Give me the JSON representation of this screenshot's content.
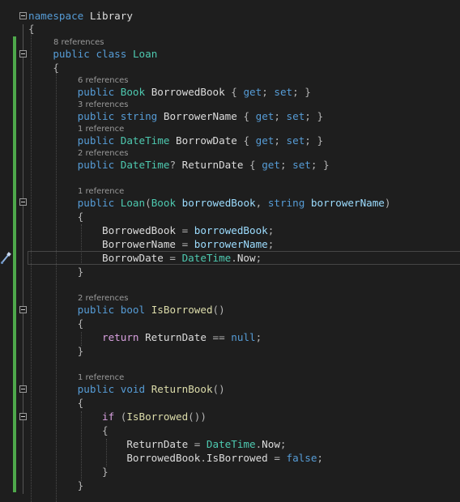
{
  "editor": {
    "lines": [
      {
        "tokens": [
          {
            "t": "namespace",
            "c": "kw"
          },
          {
            "t": " "
          },
          {
            "t": "Library",
            "c": "pr"
          }
        ]
      },
      {
        "tokens": [
          {
            "t": "{",
            "c": "pu"
          }
        ]
      },
      {
        "lens": "8 references",
        "tokens": [
          {
            "t": "    "
          },
          {
            "t": "public",
            "c": "kw"
          },
          {
            "t": " "
          },
          {
            "t": "class",
            "c": "kw"
          },
          {
            "t": " "
          },
          {
            "t": "Loan",
            "c": "ty"
          }
        ]
      },
      {
        "tokens": [
          {
            "t": "    "
          },
          {
            "t": "{",
            "c": "pu"
          }
        ]
      },
      {
        "lens": "6 references",
        "tokens": [
          {
            "t": "        "
          },
          {
            "t": "public",
            "c": "kw"
          },
          {
            "t": " "
          },
          {
            "t": "Book",
            "c": "ty"
          },
          {
            "t": " "
          },
          {
            "t": "BorrowedBook",
            "c": "pr"
          },
          {
            "t": " { ",
            "c": "pu"
          },
          {
            "t": "get",
            "c": "kw"
          },
          {
            "t": "; ",
            "c": "pu"
          },
          {
            "t": "set",
            "c": "kw"
          },
          {
            "t": "; }",
            "c": "pu"
          }
        ]
      },
      {
        "lens": "3 references",
        "tokens": [
          {
            "t": "        "
          },
          {
            "t": "public",
            "c": "kw"
          },
          {
            "t": " "
          },
          {
            "t": "string",
            "c": "kw"
          },
          {
            "t": " "
          },
          {
            "t": "BorrowerName",
            "c": "pr"
          },
          {
            "t": " { ",
            "c": "pu"
          },
          {
            "t": "get",
            "c": "kw"
          },
          {
            "t": "; ",
            "c": "pu"
          },
          {
            "t": "set",
            "c": "kw"
          },
          {
            "t": "; }",
            "c": "pu"
          }
        ]
      },
      {
        "lens": "1 reference",
        "tokens": [
          {
            "t": "        "
          },
          {
            "t": "public",
            "c": "kw"
          },
          {
            "t": " "
          },
          {
            "t": "DateTime",
            "c": "ty"
          },
          {
            "t": " "
          },
          {
            "t": "BorrowDate",
            "c": "pr"
          },
          {
            "t": " { ",
            "c": "pu"
          },
          {
            "t": "get",
            "c": "kw"
          },
          {
            "t": "; ",
            "c": "pu"
          },
          {
            "t": "set",
            "c": "kw"
          },
          {
            "t": "; }",
            "c": "pu"
          }
        ]
      },
      {
        "lens": "2 references",
        "tokens": [
          {
            "t": "        "
          },
          {
            "t": "public",
            "c": "kw"
          },
          {
            "t": " "
          },
          {
            "t": "DateTime",
            "c": "ty"
          },
          {
            "t": "? ",
            "c": "pu"
          },
          {
            "t": "ReturnDate",
            "c": "pr"
          },
          {
            "t": " { ",
            "c": "pu"
          },
          {
            "t": "get",
            "c": "kw"
          },
          {
            "t": "; ",
            "c": "pu"
          },
          {
            "t": "set",
            "c": "kw"
          },
          {
            "t": "; }",
            "c": "pu"
          }
        ]
      },
      {
        "lens": "1 reference",
        "tokens": [
          {
            "t": "        "
          },
          {
            "t": "public",
            "c": "kw"
          },
          {
            "t": " "
          },
          {
            "t": "Loan",
            "c": "ty"
          },
          {
            "t": "(",
            "c": "pu"
          },
          {
            "t": "Book",
            "c": "ty"
          },
          {
            "t": " "
          },
          {
            "t": "borrowedBook",
            "c": "pm"
          },
          {
            "t": ", ",
            "c": "pu"
          },
          {
            "t": "string",
            "c": "kw"
          },
          {
            "t": " "
          },
          {
            "t": "borrowerName",
            "c": "pm"
          },
          {
            "t": ")",
            "c": "pu"
          }
        ]
      },
      {
        "tokens": [
          {
            "t": "        "
          },
          {
            "t": "{",
            "c": "pu"
          }
        ]
      },
      {
        "tokens": [
          {
            "t": "            "
          },
          {
            "t": "BorrowedBook",
            "c": "pr"
          },
          {
            "t": " = ",
            "c": "pu"
          },
          {
            "t": "borrowedBook",
            "c": "pm"
          },
          {
            "t": ";",
            "c": "pu"
          }
        ]
      },
      {
        "tokens": [
          {
            "t": "            "
          },
          {
            "t": "BorrowerName",
            "c": "pr"
          },
          {
            "t": " = ",
            "c": "pu"
          },
          {
            "t": "borrowerName",
            "c": "pm"
          },
          {
            "t": ";",
            "c": "pu"
          }
        ]
      },
      {
        "tokens": [
          {
            "t": "            "
          },
          {
            "t": "BorrowDate",
            "c": "pr"
          },
          {
            "t": " = ",
            "c": "pu"
          },
          {
            "t": "DateTime",
            "c": "ty"
          },
          {
            "t": ".",
            "c": "pu"
          },
          {
            "t": "Now",
            "c": "pr"
          },
          {
            "t": ";",
            "c": "pu"
          }
        ]
      },
      {
        "tokens": [
          {
            "t": "        "
          },
          {
            "t": "}",
            "c": "pu"
          }
        ]
      },
      {
        "lens": "2 references",
        "tokens": [
          {
            "t": "        "
          },
          {
            "t": "public",
            "c": "kw"
          },
          {
            "t": " "
          },
          {
            "t": "bool",
            "c": "kw"
          },
          {
            "t": " "
          },
          {
            "t": "IsBorrowed",
            "c": "fn"
          },
          {
            "t": "()",
            "c": "pu"
          }
        ]
      },
      {
        "tokens": [
          {
            "t": "        "
          },
          {
            "t": "{",
            "c": "pu"
          }
        ]
      },
      {
        "tokens": [
          {
            "t": "            "
          },
          {
            "t": "return",
            "c": "ctl"
          },
          {
            "t": " "
          },
          {
            "t": "ReturnDate",
            "c": "pr"
          },
          {
            "t": " == ",
            "c": "pu"
          },
          {
            "t": "null",
            "c": "kw"
          },
          {
            "t": ";",
            "c": "pu"
          }
        ]
      },
      {
        "tokens": [
          {
            "t": "        "
          },
          {
            "t": "}",
            "c": "pu"
          }
        ]
      },
      {
        "lens": "1 reference",
        "tokens": [
          {
            "t": "        "
          },
          {
            "t": "public",
            "c": "kw"
          },
          {
            "t": " "
          },
          {
            "t": "void",
            "c": "kw"
          },
          {
            "t": " "
          },
          {
            "t": "ReturnBook",
            "c": "fn"
          },
          {
            "t": "()",
            "c": "pu"
          }
        ]
      },
      {
        "tokens": [
          {
            "t": "        "
          },
          {
            "t": "{",
            "c": "pu"
          }
        ]
      },
      {
        "tokens": [
          {
            "t": "            "
          },
          {
            "t": "if",
            "c": "ctl"
          },
          {
            "t": " (",
            "c": "pu"
          },
          {
            "t": "IsBorrowed",
            "c": "fn"
          },
          {
            "t": "())",
            "c": "pu"
          }
        ]
      },
      {
        "tokens": [
          {
            "t": "            "
          },
          {
            "t": "{",
            "c": "pu"
          }
        ]
      },
      {
        "tokens": [
          {
            "t": "                "
          },
          {
            "t": "ReturnDate",
            "c": "pr"
          },
          {
            "t": " = ",
            "c": "pu"
          },
          {
            "t": "DateTime",
            "c": "ty"
          },
          {
            "t": ".",
            "c": "pu"
          },
          {
            "t": "Now",
            "c": "pr"
          },
          {
            "t": ";",
            "c": "pu"
          }
        ]
      },
      {
        "tokens": [
          {
            "t": "                "
          },
          {
            "t": "BorrowedBook",
            "c": "pr"
          },
          {
            "t": ".",
            "c": "pu"
          },
          {
            "t": "IsBorrowed",
            "c": "pr"
          },
          {
            "t": " = ",
            "c": "pu"
          },
          {
            "t": "false",
            "c": "kw"
          },
          {
            "t": ";",
            "c": "pu"
          }
        ]
      },
      {
        "tokens": [
          {
            "t": "            "
          },
          {
            "t": "}",
            "c": "pu"
          }
        ]
      },
      {
        "tokens": [
          {
            "t": "        "
          },
          {
            "t": "}",
            "c": "pu"
          }
        ]
      }
    ]
  },
  "colors": {
    "keyword": "#569cd6",
    "control": "#d8a0df",
    "type": "#4ec9b0",
    "method": "#dcdcaa",
    "param": "#9cdcfe",
    "change_bar": "#4ea84b"
  }
}
